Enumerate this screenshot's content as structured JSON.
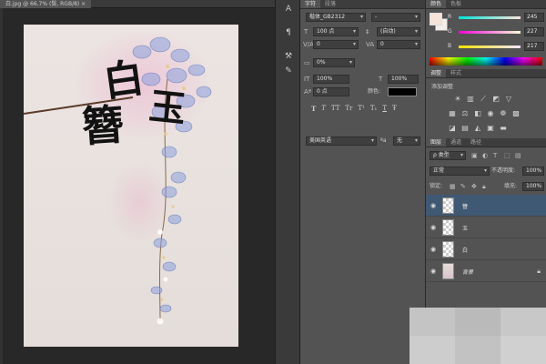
{
  "document": {
    "tab_title": "白.jpg @ 66.7% (鬓, RGB/8) ×"
  },
  "artwork": {
    "calligraphy": [
      "白",
      "玉",
      "簪"
    ]
  },
  "character_panel": {
    "tabs": [
      "字符",
      "段落"
    ],
    "font_family": "楷体_GB2312",
    "font_style": "-",
    "font_size": "100 点",
    "leading": "(自动)",
    "kerning": "0",
    "tracking": "0",
    "scale_percent": "0%",
    "vertical_scale": "100%",
    "horizontal_scale": "100%",
    "baseline_shift": "0 点",
    "color_label": "颜色:",
    "type_styles": [
      "T",
      "T",
      "TT",
      "Tr",
      "T¹",
      "T₁",
      "T",
      "Ŧ"
    ],
    "language": "美国英语",
    "antialias": "无",
    "antialias_prefix": "ªa"
  },
  "color_panel": {
    "tabs": [
      "颜色",
      "色板"
    ],
    "channels": [
      {
        "name": "R",
        "value": "245"
      },
      {
        "name": "G",
        "value": "227"
      },
      {
        "name": "B",
        "value": "217"
      }
    ]
  },
  "adjust_panel": {
    "tabs": [
      "调整",
      "样式"
    ],
    "title": "添加调整"
  },
  "layers_panel": {
    "tabs": [
      "图层",
      "通道",
      "路径"
    ],
    "filter_kind": "ρ 类型",
    "blend_mode": "正常",
    "opacity_label": "不透明度:",
    "opacity_value": "100%",
    "lock_label": "锁定:",
    "fill_label": "填充:",
    "fill_value": "100%",
    "layers": [
      {
        "name": "簪",
        "selected": true,
        "locked": false
      },
      {
        "name": "玉",
        "selected": false,
        "locked": false
      },
      {
        "name": "白",
        "selected": false,
        "locked": false
      },
      {
        "name": "背景",
        "selected": false,
        "locked": true
      }
    ]
  },
  "colors": {
    "foreground": "#f5e3d9",
    "background": "#f5ede9",
    "selected_layer": "#3f5873"
  }
}
